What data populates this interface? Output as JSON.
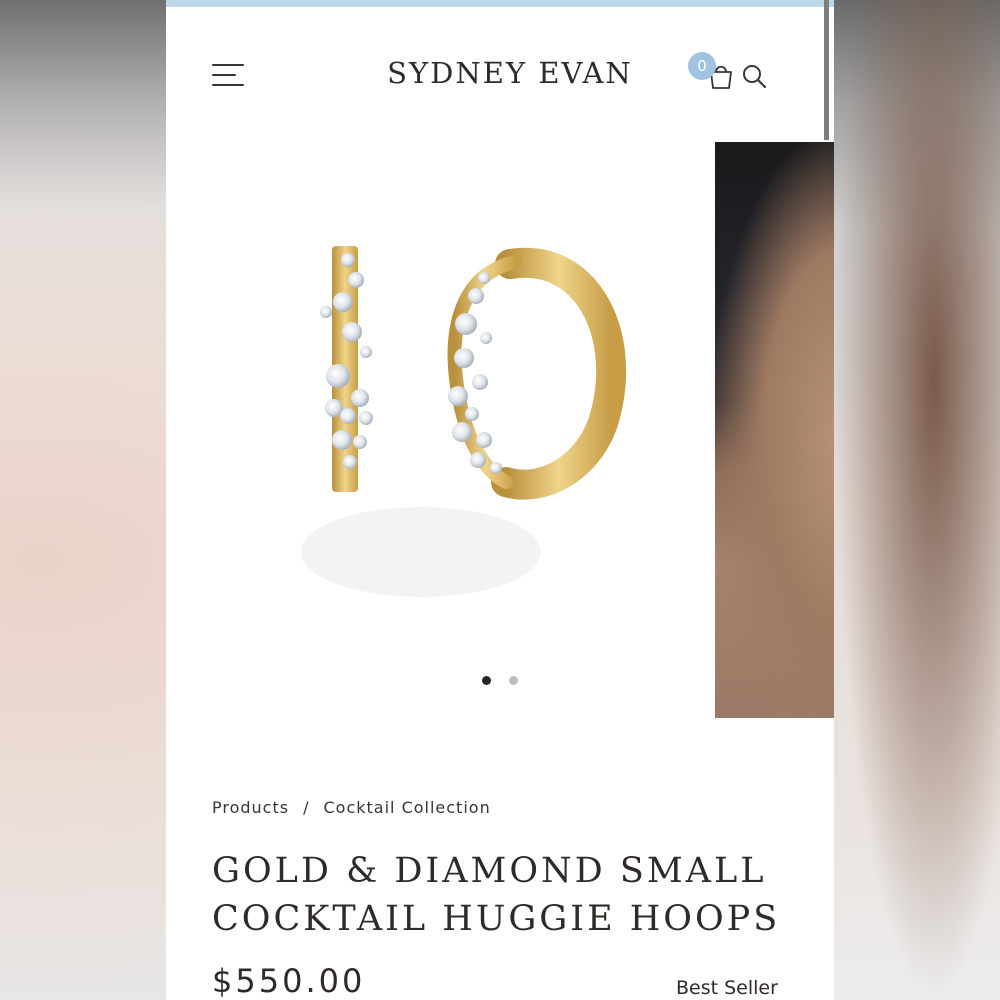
{
  "header": {
    "brand": "SYDNEY EVAN",
    "cart_count": "0"
  },
  "gallery": {
    "main_image": "gold-diamond-huggie-hoops-photo",
    "next_image": "earring-on-model-photo",
    "slide_count": 2,
    "active_slide": 1
  },
  "breadcrumb": {
    "items": [
      "Products",
      "Cocktail Collection"
    ],
    "separator": "/"
  },
  "product": {
    "title_line1": "GOLD & DIAMOND SMALL",
    "title_line2": "COCKTAIL HUGGIE HOOPS",
    "price": "$550.00",
    "badge": "Best Seller"
  },
  "colors": {
    "accent_blue": "#9fc3e0",
    "text_dark": "#2f2a28",
    "gold": "#d9b45a",
    "dot_active": "#2a2220",
    "dot_inactive": "#bdbdbd"
  },
  "icons": {
    "menu": "hamburger-icon",
    "cart": "shopping-bag-icon",
    "search": "search-icon"
  }
}
